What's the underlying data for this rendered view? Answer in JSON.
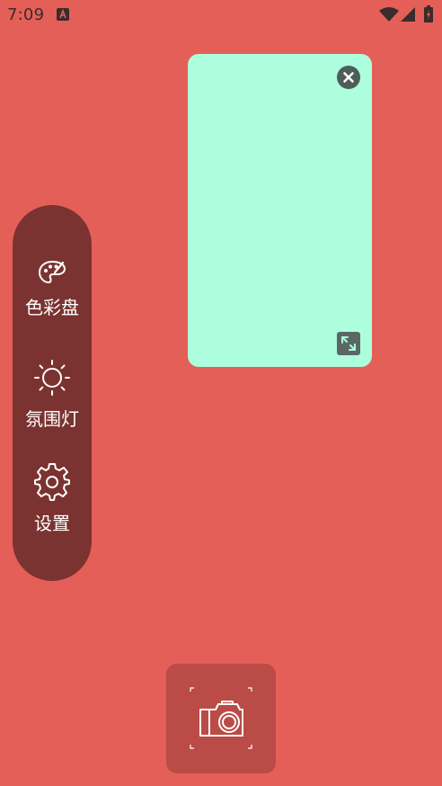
{
  "status_bar": {
    "time": "7:09",
    "icons": [
      "app-notification-icon",
      "wifi-icon",
      "cellular-signal-icon",
      "battery-icon"
    ]
  },
  "preview_card": {
    "color": "#adfedd",
    "close_icon": "close-icon",
    "expand_icon": "expand-icon"
  },
  "side_menu": {
    "items": [
      {
        "label": "色彩盘",
        "icon": "palette-icon"
      },
      {
        "label": "氛围灯",
        "icon": "sun-icon"
      },
      {
        "label": "设置",
        "icon": "gear-icon"
      }
    ]
  },
  "camera": {
    "icon": "camera-icon"
  },
  "colors": {
    "background": "#e45f58",
    "menu": "#7a3330",
    "camera_button": "#ba4b46"
  }
}
